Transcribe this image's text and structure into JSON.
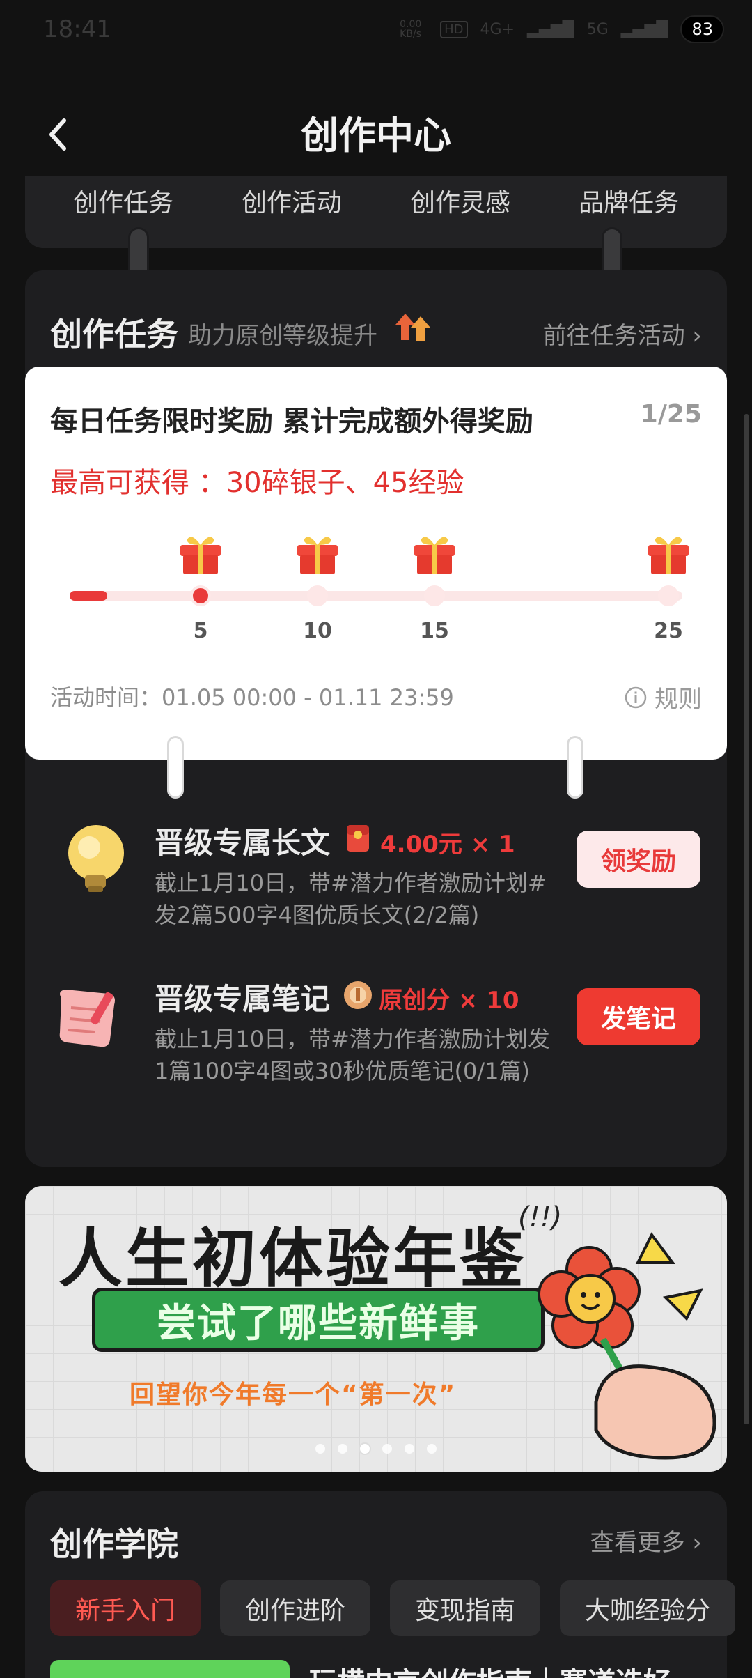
{
  "status_bar": {
    "time": "18:41",
    "net_speed": "0.00 KB/s",
    "hd": "HD",
    "signal_1": "4G+",
    "signal_2": "5G",
    "battery": "83"
  },
  "header": {
    "title": "创作中心"
  },
  "top_tabs": [
    "创作任务",
    "创作活动",
    "创作灵感",
    "品牌任务"
  ],
  "task_section": {
    "title": "创作任务",
    "subtitle": "助力原创等级提升",
    "link": "前往任务活动 ›"
  },
  "reward_card": {
    "title": "每日任务限时奖励 累计完成额外得奖励",
    "counter": "1/25",
    "max_reward": "最高可获得 ：30碎银子、45经验",
    "progress_value": 1,
    "progress_max": 25,
    "milestones": [
      "5",
      "10",
      "15",
      "25"
    ],
    "time_label": "活动时间：01.05  00:00  -  01.11  23:59",
    "rules_label": "规则"
  },
  "tasks": [
    {
      "title": "晋级专属长文",
      "reward": "4.00元 × 1",
      "desc": "截止1月10日，带#潜力作者激励计划#发2篇500字4图优质长文(2/2篇)",
      "button": "领奖励"
    },
    {
      "title": "晋级专属笔记",
      "reward": "原创分 × 10",
      "desc": "截止1月10日，带#潜力作者激励计划发1篇100字4图或30秒优质笔记(0/1篇)",
      "button": "发笔记"
    }
  ],
  "banner": {
    "title": "人生初体验年鉴",
    "exclaim": "(!!)",
    "pill": "尝试了哪些新鲜事",
    "sub": "回望你今年每一个“第一次”",
    "dots_total": 6,
    "dots_active": 3
  },
  "academy": {
    "title": "创作学院",
    "link": "查看更多 ›",
    "chips": [
      "新手入门",
      "创作进阶",
      "变现指南",
      "大咖经验分"
    ],
    "peek_text": "玩横中京创作指南｜赛道选好"
  },
  "colors": {
    "accent_red": "#e93a3a",
    "background": "#121212",
    "card_dark": "#1e1e20"
  }
}
